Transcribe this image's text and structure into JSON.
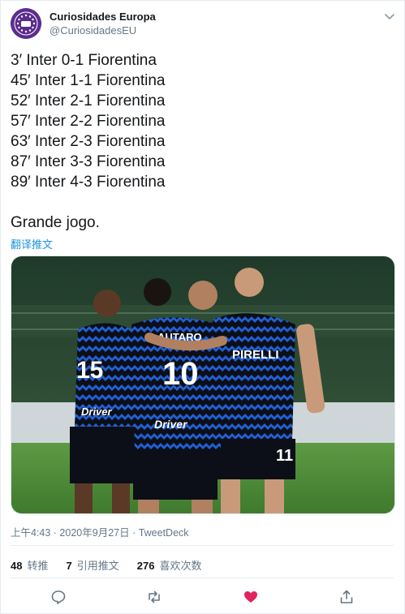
{
  "author": {
    "name": "Curiosidades Europa",
    "handle": "@CuriosidadesEU",
    "avatar_text": "CURIOSIDADES EUROPA"
  },
  "tweet": {
    "text": "3′ Inter 0-1 Fiorentina\n45′ Inter 1-1 Fiorentina\n52′ Inter 2-1 Fiorentina\n57′ Inter 2-2 Fiorentina\n63′ Inter 2-3 Fiorentina\n87′ Inter 3-3 Fiorentina\n89′ Inter 4-3 Fiorentina\n\nGrande jogo.",
    "translate_label": "翻译推文"
  },
  "photo": {
    "jersey_names": [
      "LAUTARO"
    ],
    "jersey_numbers": [
      "15",
      "10",
      "11"
    ],
    "sponsor": "Driver",
    "sponsor_back": "PIRELLI",
    "colors": {
      "pitch": "#4f8a3a",
      "kit_blue": "#1f4fb3",
      "kit_black": "#0c0f17"
    }
  },
  "meta": {
    "timestamp": "上午4:43 · 2020年9月27日 · TweetDeck"
  },
  "stats": {
    "retweets_count": "48",
    "retweets_label": "转推",
    "quotes_count": "7",
    "quotes_label": "引用推文",
    "likes_count": "276",
    "likes_label": "喜欢次数"
  },
  "actions": {
    "reply_icon": "reply-icon",
    "retweet_icon": "retweet-icon",
    "like_icon": "heart-icon",
    "share_icon": "share-icon"
  },
  "colors": {
    "accent": "#1b95e0",
    "like": "#e0245e",
    "muted": "#657786",
    "avatar": "#5b2d8f"
  }
}
